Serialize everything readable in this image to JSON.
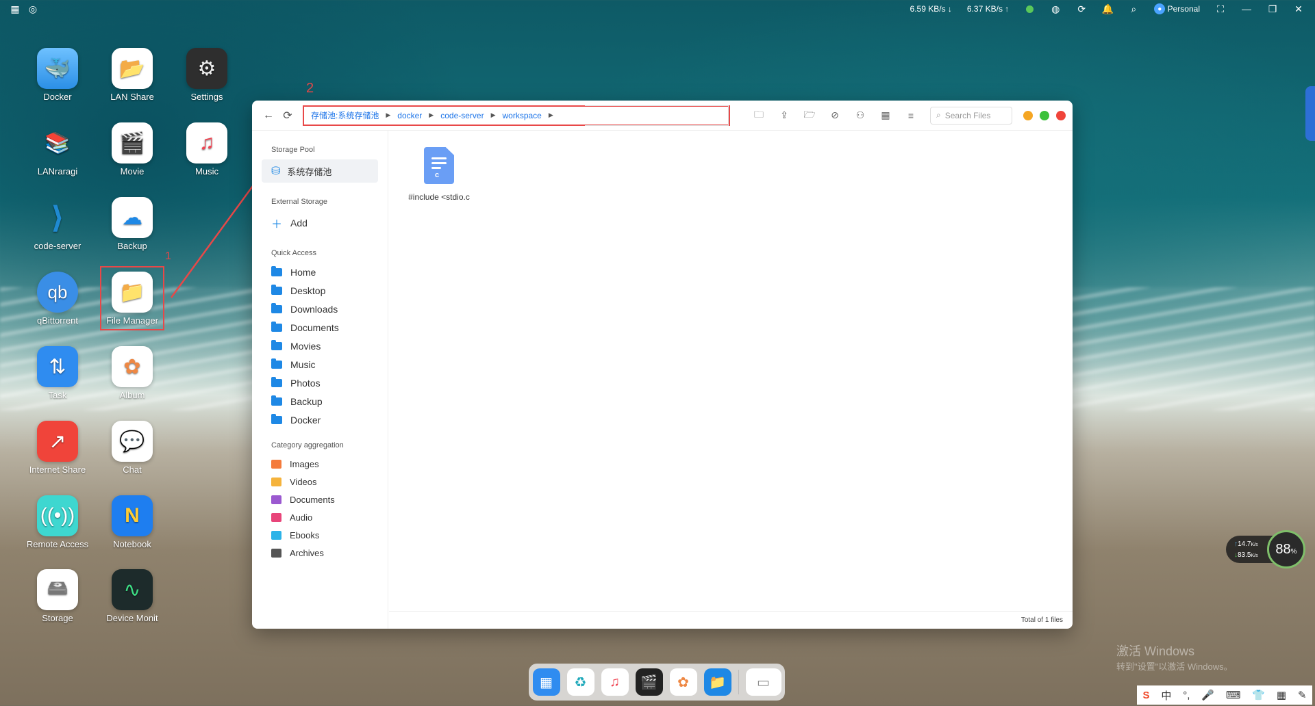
{
  "topbar": {
    "download_speed": "6.59 KB/s",
    "upload_speed": "6.37 KB/s",
    "user": "Personal"
  },
  "desktop_icons": [
    {
      "label": "Docker"
    },
    {
      "label": "LAN Share"
    },
    {
      "label": "Settings"
    },
    {
      "label": "LANraragi"
    },
    {
      "label": "Movie"
    },
    {
      "label": "Music"
    },
    {
      "label": "code-server"
    },
    {
      "label": "Backup"
    },
    {
      "label": "qBittorrent"
    },
    {
      "label": "File Manager"
    },
    {
      "label": "Task"
    },
    {
      "label": "Album"
    },
    {
      "label": "Internet Share"
    },
    {
      "label": "Chat"
    },
    {
      "label": "Remote Access"
    },
    {
      "label": "Notebook"
    },
    {
      "label": "Storage"
    },
    {
      "label": "Device Monit"
    }
  ],
  "annotations": {
    "one": "1",
    "two": "2"
  },
  "file_manager": {
    "breadcrumbs": [
      "存储池:系统存储池",
      "docker",
      "code-server",
      "workspace"
    ],
    "search_placeholder": "Search Files",
    "sidebar": {
      "storage_pool_title": "Storage Pool",
      "storage_pool_item": "系统存储池",
      "external_title": "External Storage",
      "add_label": "Add",
      "quick_title": "Quick Access",
      "quick_items": [
        "Home",
        "Desktop",
        "Downloads",
        "Documents",
        "Movies",
        "Music",
        "Photos",
        "Backup",
        "Docker"
      ],
      "category_title": "Category aggregation",
      "categories": [
        "Images",
        "Videos",
        "Documents",
        "Audio",
        "Ebooks",
        "Archives"
      ]
    },
    "files": [
      {
        "name": "#include <stdio.c"
      }
    ],
    "status": "Total of 1 files"
  },
  "widget": {
    "up": "14.7",
    "down": "83.5",
    "unit": "K/s",
    "percent": "88",
    "pct_sign": "%"
  },
  "watermark": {
    "line1": "激活 Windows",
    "line2": "转到\"设置\"以激活 Windows。"
  },
  "ime": {
    "lang": "中"
  },
  "colors": {
    "accent": "#1a73e8",
    "annotation": "#e84848",
    "folder": "#1e88e5"
  }
}
